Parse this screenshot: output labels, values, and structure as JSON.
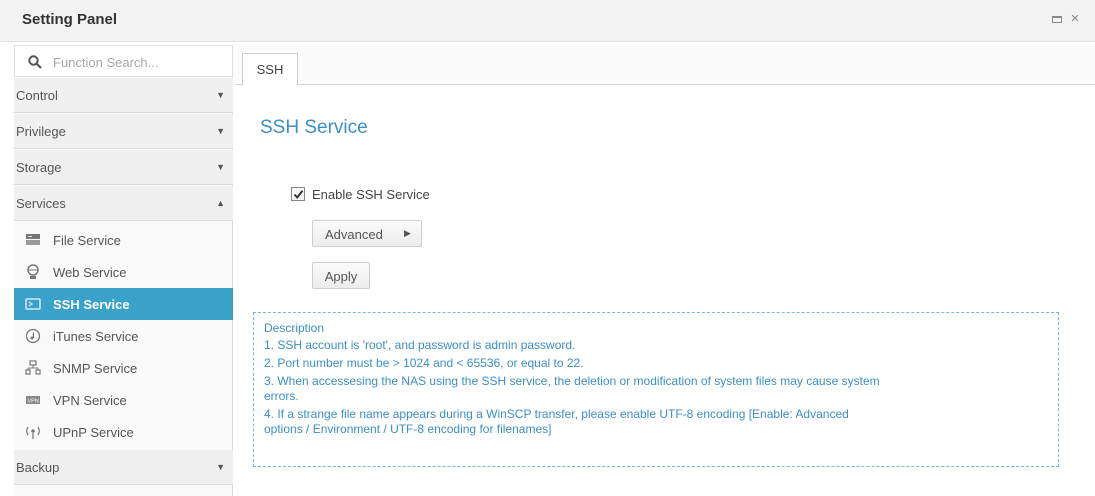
{
  "window": {
    "title": "Setting Panel"
  },
  "sidebar": {
    "search_placeholder": "Function Search...",
    "categories": [
      {
        "label": "Control",
        "expanded": false
      },
      {
        "label": "Privilege",
        "expanded": false
      },
      {
        "label": "Storage",
        "expanded": false
      },
      {
        "label": "Services",
        "expanded": true
      },
      {
        "label": "Backup",
        "expanded": false
      }
    ],
    "services": [
      {
        "label": "File Service",
        "icon": "file-service-icon"
      },
      {
        "label": "Web Service",
        "icon": "web-service-icon"
      },
      {
        "label": "SSH Service",
        "icon": "ssh-service-icon",
        "active": true
      },
      {
        "label": "iTunes Service",
        "icon": "itunes-icon"
      },
      {
        "label": "SNMP Service",
        "icon": "snmp-icon"
      },
      {
        "label": "VPN Service",
        "icon": "vpn-icon"
      },
      {
        "label": "UPnP Service",
        "icon": "upnp-icon"
      }
    ]
  },
  "main": {
    "tab": "SSH",
    "section_title": "SSH Service",
    "enable_label": "Enable SSH Service",
    "enable_checked": true,
    "advanced_label": "Advanced",
    "apply_label": "Apply",
    "description": {
      "heading": "Description",
      "lines": [
        "1. SSH account is 'root', and password is admin password.",
        "2. Port number must be > 1024 and < 65536, or equal to 22.",
        "3. When accessesing the NAS using the SSH service, the deletion or modification of system files may cause system",
        "errors.",
        "4. If a strange file name appears during a WinSCP transfer, please enable UTF-8 encoding [Enable: Advanced",
        "options / Environment / UTF-8 encoding for filenames]"
      ]
    }
  },
  "colors": {
    "accent": "#3aa2c8",
    "link_blue": "#3d8fc4"
  }
}
